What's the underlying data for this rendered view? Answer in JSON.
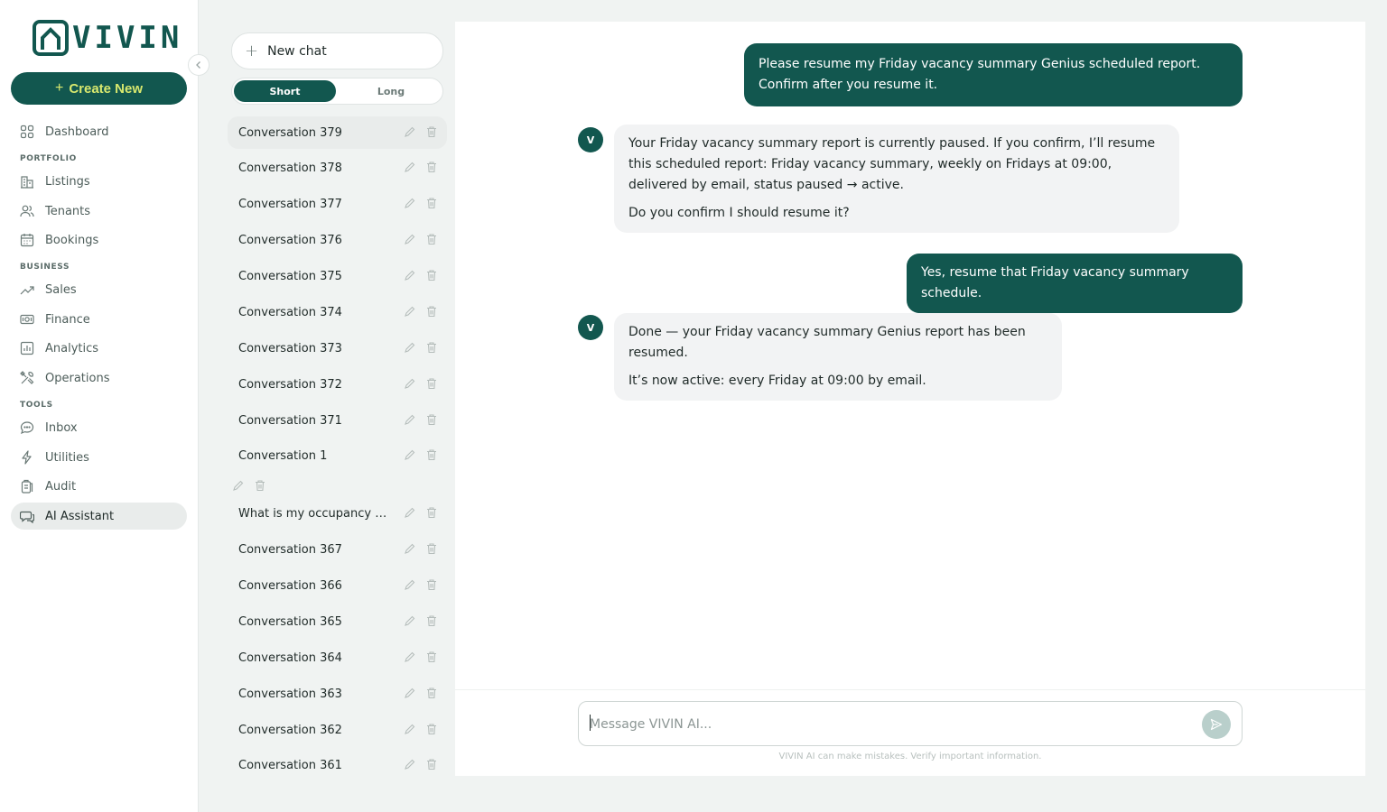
{
  "brand": {
    "name": "VIVIN",
    "color": "#12574f",
    "accent": "#d8e86e"
  },
  "sidebar": {
    "create_label": "Create New",
    "collapse_icon": "chevron-left-icon",
    "sections": {
      "portfolio": "PORTFOLIO",
      "business": "BUSINESS",
      "tools": "TOOLS"
    },
    "items": [
      {
        "label": "Dashboard",
        "icon": "grid-icon"
      },
      {
        "label": "Listings",
        "icon": "building-icon"
      },
      {
        "label": "Tenants",
        "icon": "users-icon"
      },
      {
        "label": "Bookings",
        "icon": "calendar-icon"
      },
      {
        "label": "Sales",
        "icon": "trend-icon"
      },
      {
        "label": "Finance",
        "icon": "cash-icon"
      },
      {
        "label": "Analytics",
        "icon": "bar-chart-icon"
      },
      {
        "label": "Operations",
        "icon": "tools-icon"
      },
      {
        "label": "Inbox",
        "icon": "chat-bubble-icon"
      },
      {
        "label": "Utilities",
        "icon": "bolt-icon"
      },
      {
        "label": "Audit",
        "icon": "clipboard-icon"
      },
      {
        "label": "AI Assistant",
        "icon": "ai-chat-icon",
        "active": true
      }
    ]
  },
  "conversations": {
    "new_chat_label": "New chat",
    "toggle": {
      "short": "Short",
      "long": "Long",
      "selected": "Short"
    },
    "items": [
      "Conversation 379",
      "Conversation 378",
      "Conversation 377",
      "Conversation 376",
      "Conversation 375",
      "Conversation 374",
      "Conversation 373",
      "Conversation 372",
      "Conversation 371",
      "Conversation 1",
      "What is my occupancy bri...",
      "Conversation 367",
      "Conversation 366",
      "Conversation 365",
      "Conversation 364",
      "Conversation 363",
      "Conversation 362",
      "Conversation 361"
    ]
  },
  "chat": {
    "assistant_initial": "V",
    "messages": [
      {
        "role": "user",
        "paragraphs": [
          "Please resume my Friday vacancy summary Genius scheduled report. Confirm after you resume it."
        ]
      },
      {
        "role": "assistant",
        "paragraphs": [
          "Your Friday vacancy summary report is currently paused. If you confirm, I’ll resume this scheduled report: Friday vacancy summary, weekly on Fridays at 09:00, delivered by email, status paused → active.",
          "Do you confirm I should resume it?"
        ]
      },
      {
        "role": "user",
        "paragraphs": [
          "Yes, resume that Friday vacancy summary schedule."
        ]
      },
      {
        "role": "assistant",
        "paragraphs": [
          "Done — your Friday vacancy summary Genius report has been resumed.",
          "It’s now active: every Friday at 09:00 by email."
        ]
      }
    ],
    "input": {
      "value": "",
      "placeholder": "Message VIVIN AI..."
    },
    "disclaimer": "VIVIN AI can make mistakes. Verify important information."
  }
}
